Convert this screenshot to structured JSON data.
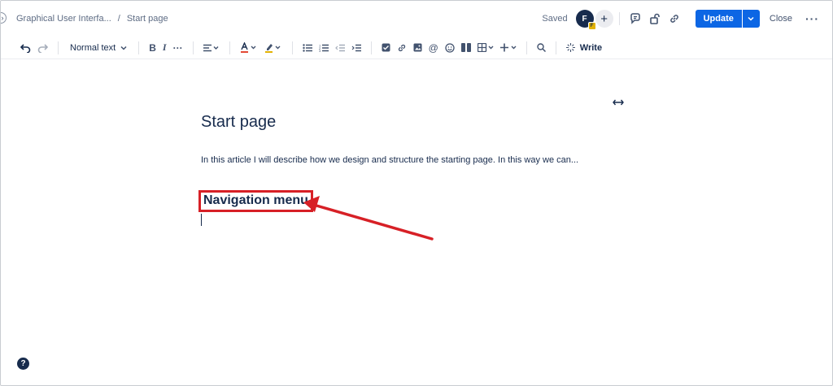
{
  "header": {
    "breadcrumb": [
      "Graphical User Interfa...",
      "Start page"
    ],
    "breadcrumb_separator": "/",
    "saved_label": "Saved",
    "avatar_initial": "F",
    "avatar_badge": "F",
    "invite_label": "+",
    "update_label": "Update",
    "close_label": "Close",
    "more_label": "···",
    "accent_color": "#0c66e4"
  },
  "toolbar": {
    "text_style": "Normal text",
    "bold": "B",
    "italic": "I",
    "more_formatting": "···",
    "write_label": "Write"
  },
  "content": {
    "title": "Start page",
    "body": "In this article I will describe how we design and structure the starting page. In this way we can...",
    "heading": "Navigation menu",
    "highlight_color": "#d72026"
  },
  "help_label": "?"
}
